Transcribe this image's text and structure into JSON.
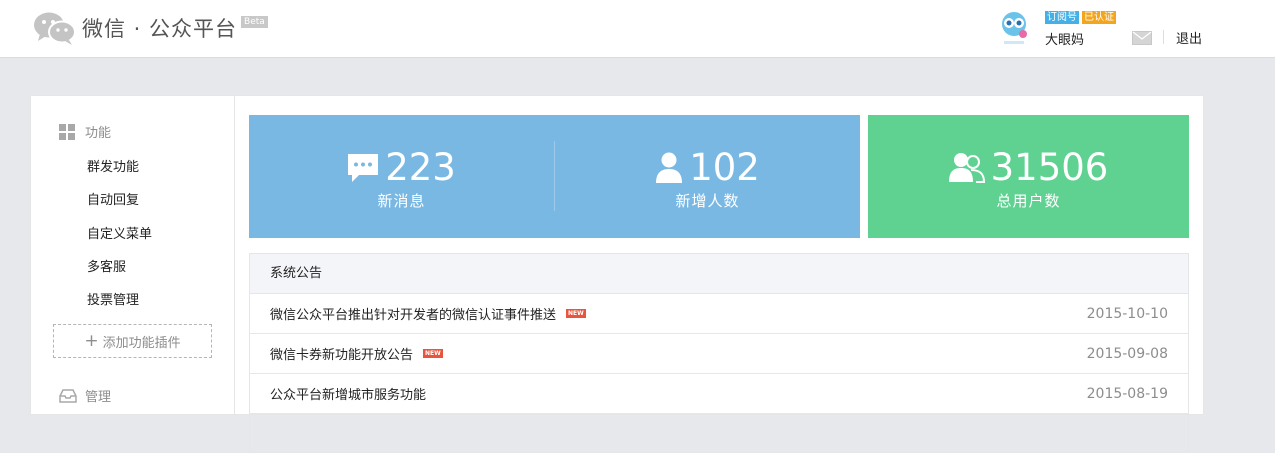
{
  "header": {
    "logo_text": "微信 · 公众平台",
    "beta": "Beta",
    "badges": {
      "subscription": "订阅号",
      "verified": "已认证"
    },
    "username": "大眼妈",
    "logout": "退出"
  },
  "sidebar": {
    "section_function": "功能",
    "items": [
      {
        "label": "群发功能"
      },
      {
        "label": "自动回复"
      },
      {
        "label": "自定义菜单"
      },
      {
        "label": "多客服"
      },
      {
        "label": "投票管理"
      }
    ],
    "add_plugin": "添加功能插件",
    "section_manage": "管理"
  },
  "stats": {
    "messages": {
      "value": "223",
      "label": "新消息"
    },
    "new_users": {
      "value": "102",
      "label": "新增人数"
    },
    "total_users": {
      "value": "31506",
      "label": "总用户数"
    }
  },
  "notice": {
    "title": "系统公告",
    "new_badge": "NEW",
    "items": [
      {
        "title": "微信公众平台推出针对开发者的微信认证事件推送",
        "date": "2015-10-10"
      },
      {
        "title": "微信卡券新功能开放公告",
        "date": "2015-09-08"
      },
      {
        "title": "公众平台新增城市服务功能",
        "date": "2015-08-19"
      }
    ]
  },
  "colors": {
    "stat_blue": "#7ab8e4",
    "stat_green": "#5fd292",
    "badge_subscription": "#44b0e6",
    "badge_verified": "#f3a51d",
    "new_tag": "#e9543c"
  }
}
